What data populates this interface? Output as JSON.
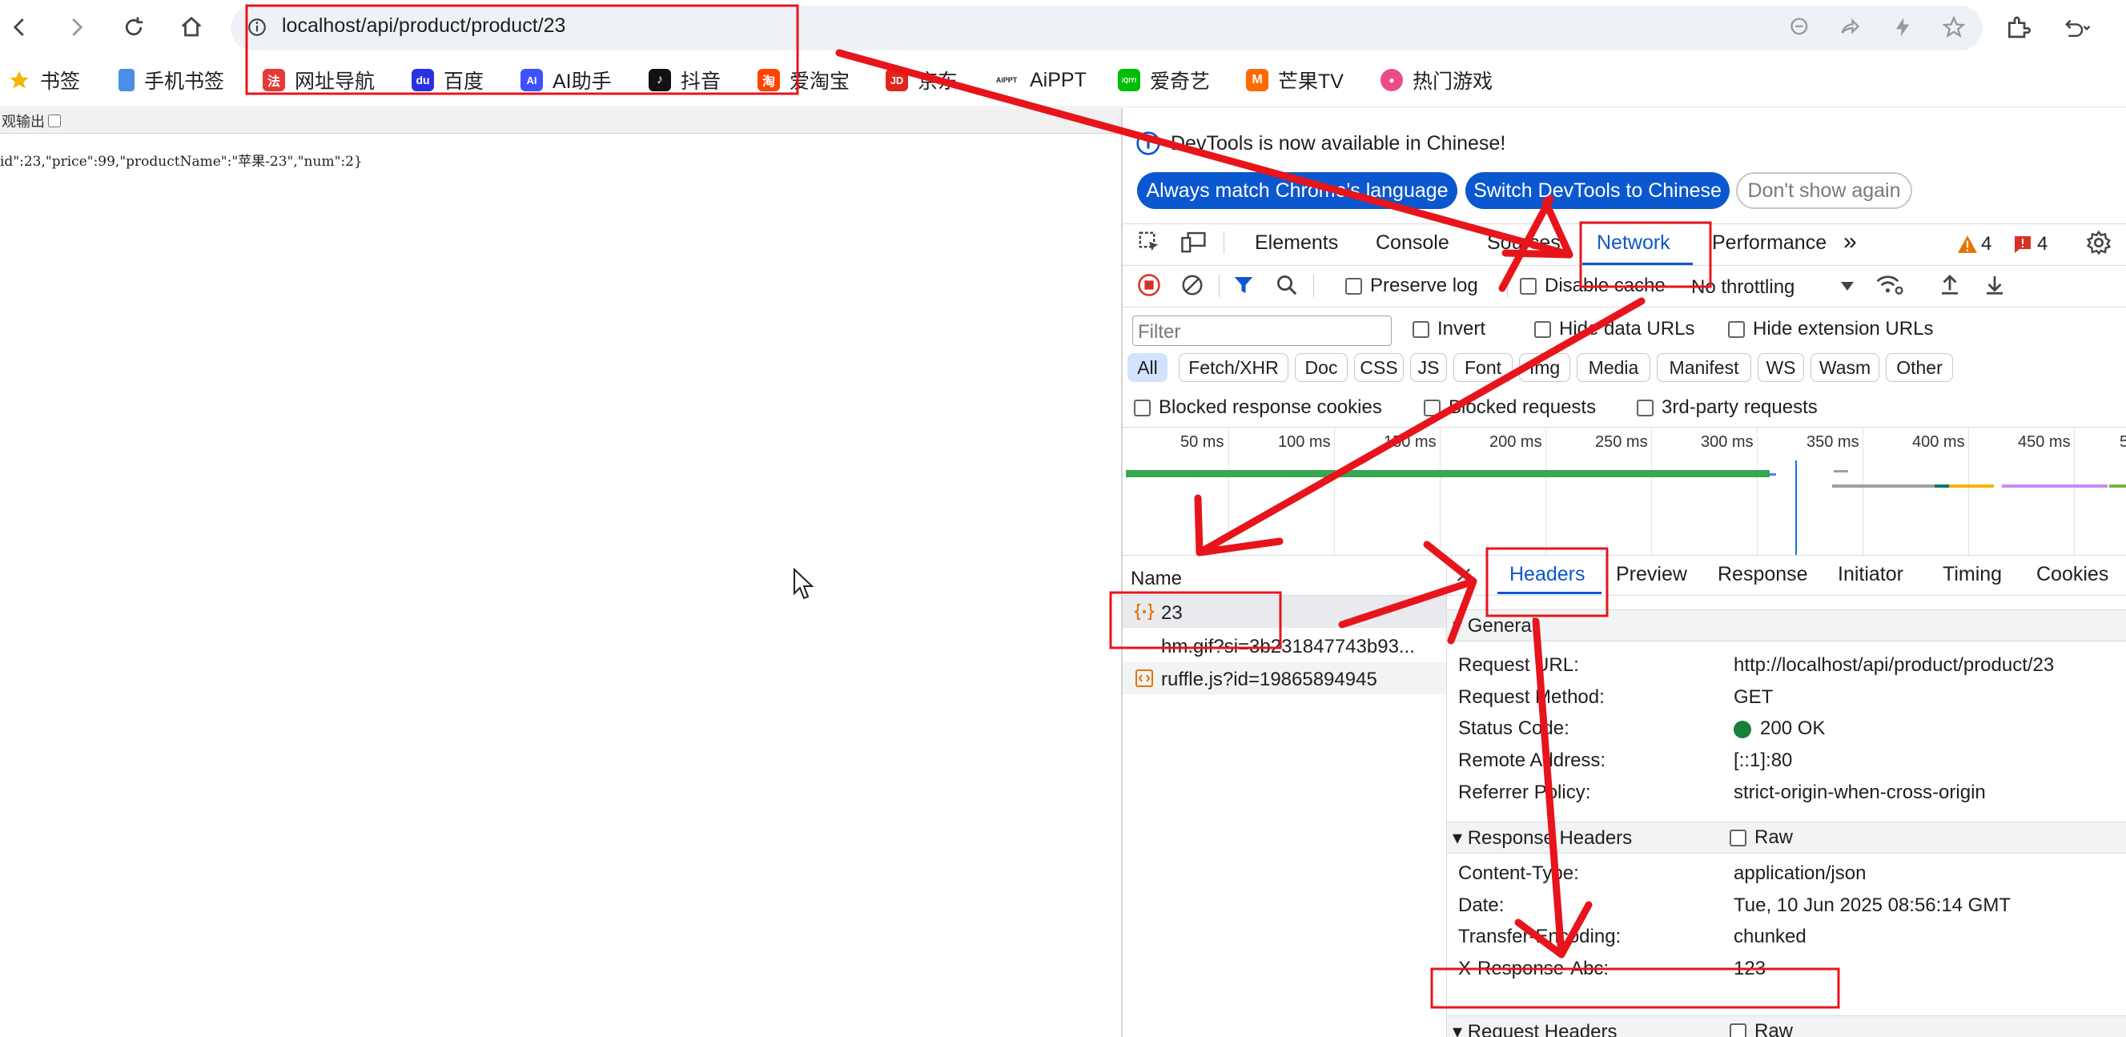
{
  "browser": {
    "url": "localhost/api/product/product/23",
    "bookmarks": [
      {
        "label": "书签",
        "icon": "star-icon",
        "color": "#f5b400"
      },
      {
        "label": "手机书签",
        "icon": "phone-icon",
        "color": "#4a90e2"
      },
      {
        "label": "网址导航",
        "icon": "nav-site-icon",
        "color": "#e53935",
        "glyph": "法"
      },
      {
        "label": "百度",
        "icon": "baidu-icon",
        "color": "#2932e1",
        "glyph": "du"
      },
      {
        "label": "AI助手",
        "icon": "ai-assistant-icon",
        "color": "#3f51ff",
        "glyph": "AI"
      },
      {
        "label": "抖音",
        "icon": "douyin-icon",
        "color": "#111111",
        "glyph": "♪"
      },
      {
        "label": "爱淘宝",
        "icon": "taobao-icon",
        "color": "#ff4400",
        "glyph": "淘"
      },
      {
        "label": "京东",
        "icon": "jd-icon",
        "color": "#e1251b",
        "glyph": "JD"
      },
      {
        "label": "AiPPT",
        "icon": "aippt-icon",
        "color": "#222222",
        "glyph": "AiPPT"
      },
      {
        "label": "爱奇艺",
        "icon": "iqiyi-icon",
        "color": "#00be06",
        "glyph": "iQIYI"
      },
      {
        "label": "芒果TV",
        "icon": "mango-tv-icon",
        "color": "#ff6a00",
        "glyph": "M"
      },
      {
        "label": "热门游戏",
        "icon": "games-icon",
        "color": "#ea4c89",
        "glyph": "●"
      }
    ]
  },
  "page": {
    "pretty_print_label": "观输出",
    "json_text": "id\":23,\"price\":99,\"productName\":\"苹果-23\",\"num\":2}"
  },
  "devtools": {
    "banner": "DevTools is now available in Chinese!",
    "btn_match": "Always match Chrome's language",
    "btn_switch": "Switch DevTools to Chinese",
    "btn_dismiss": "Don't show again",
    "tabs": [
      "Elements",
      "Console",
      "Sources",
      "Network",
      "Performance"
    ],
    "active_tab": "Network",
    "warnings": "4",
    "errors": "4",
    "preserve_log": "Preserve log",
    "disable_cache": "Disable cache",
    "throttling": "No throttling",
    "filter_placeholder": "Filter",
    "invert": "Invert",
    "hide_data_urls": "Hide data URLs",
    "hide_ext_urls": "Hide extension URLs",
    "types": [
      "All",
      "Fetch/XHR",
      "Doc",
      "CSS",
      "JS",
      "Font",
      "Img",
      "Media",
      "Manifest",
      "WS",
      "Wasm",
      "Other"
    ],
    "blocked_cookies": "Blocked response cookies",
    "blocked_requests": "Blocked requests",
    "third_party": "3rd-party requests",
    "ticks": [
      "50 ms",
      "100 ms",
      "150 ms",
      "200 ms",
      "250 ms",
      "300 ms",
      "350 ms",
      "400 ms",
      "450 ms",
      "5"
    ],
    "name_header": "Name",
    "requests": [
      "23",
      "hm.gif?si=3b231847743b93...",
      "ruffle.js?id=19865894945"
    ],
    "detail_tabs": [
      "Headers",
      "Preview",
      "Response",
      "Initiator",
      "Timing",
      "Cookies"
    ],
    "general_title": "General",
    "general": [
      {
        "k": "Request URL:",
        "v": "http://localhost/api/product/product/23"
      },
      {
        "k": "Request Method:",
        "v": "GET"
      },
      {
        "k": "Status Code:",
        "v": "200 OK"
      },
      {
        "k": "Remote Address:",
        "v": "[::1]:80"
      },
      {
        "k": "Referrer Policy:",
        "v": "strict-origin-when-cross-origin"
      }
    ],
    "response_headers_title": "Response Headers",
    "raw": "Raw",
    "response_headers": [
      {
        "k": "Content-Type:",
        "v": "application/json"
      },
      {
        "k": "Date:",
        "v": "Tue, 10 Jun 2025 08:56:14 GMT"
      },
      {
        "k": "Transfer-Encoding:",
        "v": "chunked"
      },
      {
        "k": "X-Response-Abc:",
        "v": "123"
      }
    ],
    "request_headers_title": "Request Headers"
  },
  "colors": {
    "accent_blue": "#0b57d0",
    "annotation_red": "#e8141c",
    "status_green": "#188038",
    "warning": "#e37400",
    "error": "#d93025"
  }
}
